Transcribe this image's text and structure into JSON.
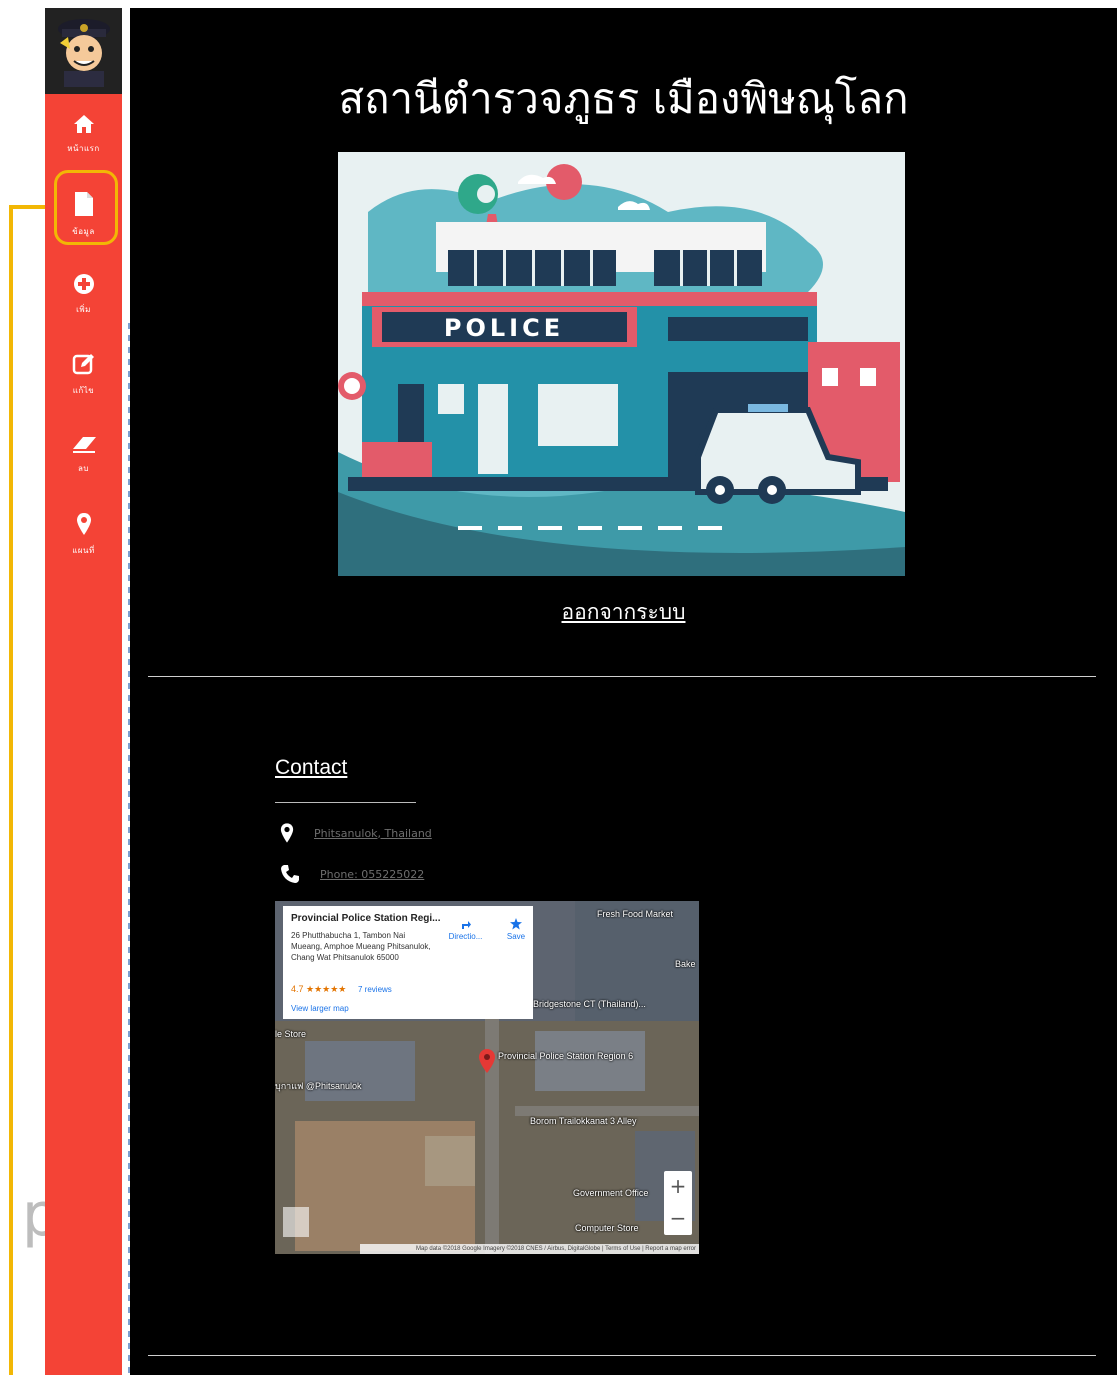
{
  "sidebar": {
    "items": [
      {
        "label": "หน้าแรก",
        "icon": "home-icon"
      },
      {
        "label": "ข้อมูล",
        "icon": "file-icon"
      },
      {
        "label": "เพิ่ม",
        "icon": "plus-circle-icon"
      },
      {
        "label": "แก้ไข",
        "icon": "edit-icon"
      },
      {
        "label": "ลบ",
        "icon": "eraser-icon"
      },
      {
        "label": "แผนที่",
        "icon": "map-marker-icon"
      }
    ]
  },
  "header": {
    "title": "สถานีตำรวจภูธร เมืองพิษณุโลก"
  },
  "hero": {
    "sign_text": "POLICE"
  },
  "logout_label": "ออกจากระบบ",
  "contact": {
    "title": "Contact",
    "location": "Phitsanulok, Thailand",
    "phone": "Phone: 055225022"
  },
  "map": {
    "place_name": "Provincial Police Station Regi...",
    "address": "26 Phutthabucha 1, Tambon Nai Mueang, Amphoe Mueang Phitsanulok, Chang Wat Phitsanulok 65000",
    "rating": "4.7 ★★★★★",
    "reviews": "7 reviews",
    "view_larger": "View larger map",
    "directions": "Directio...",
    "save": "Save",
    "zoom_in": "+",
    "zoom_out": "−",
    "footer": "Map data ©2018 Google Imagery ©2018 CNES / Airbus, DigitalGlobe | Terms of Use | Report a map error",
    "labels": {
      "pin": "Provincial Police Station Region 6",
      "bridgestone": "Bridgestone CT (Thailand)...",
      "store": "le Store",
      "cafe": "บุกาแฟ @Phitsanulok",
      "alley": "Borom Trailokkanat 3 Alley",
      "gov": "Government Office",
      "computer": "Computer Store",
      "fresh": "Fresh Food Market",
      "bake": "Bake"
    }
  },
  "colors": {
    "sidebar": "#f44336",
    "main_bg": "#000000",
    "annotation": "#f2b705"
  }
}
